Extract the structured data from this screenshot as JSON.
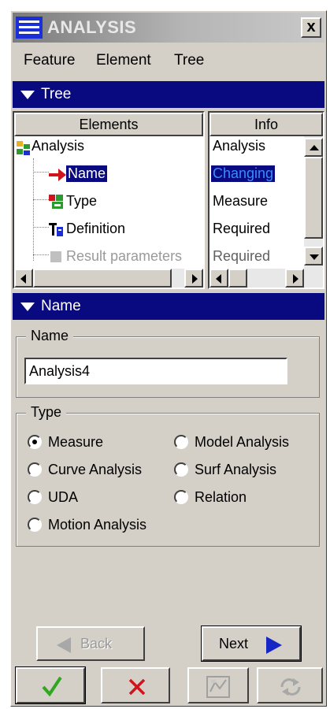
{
  "window": {
    "title": "ANALYSIS",
    "close_glyph": "x"
  },
  "menu": {
    "items": [
      "Feature",
      "Element",
      "Tree"
    ]
  },
  "tree_section": {
    "label": "Tree"
  },
  "tree": {
    "col_elements": "Elements",
    "col_info": "Info",
    "rows": [
      {
        "element": "Analysis",
        "info": "Analysis",
        "icon": "analysis-feature-icon"
      },
      {
        "element": "Name",
        "info": "Changing",
        "icon": "current-arrow-icon",
        "selected": true
      },
      {
        "element": "Type",
        "info": "Measure",
        "icon": "type-icon"
      },
      {
        "element": "Definition",
        "info": "Required",
        "icon": "definition-icon"
      },
      {
        "element": "Result parameters",
        "info": "Required",
        "icon": "result-parameters-icon"
      }
    ]
  },
  "name_section": {
    "label": "Name"
  },
  "name_group": {
    "label": "Name",
    "value": "Analysis4"
  },
  "type_group": {
    "label": "Type",
    "options": [
      {
        "label": "Measure",
        "checked": true
      },
      {
        "label": "Model Analysis",
        "checked": false
      },
      {
        "label": "Curve Analysis",
        "checked": false
      },
      {
        "label": "Surf Analysis",
        "checked": false
      },
      {
        "label": "UDA",
        "checked": false
      },
      {
        "label": "Relation",
        "checked": false
      },
      {
        "label": "Motion Analysis",
        "checked": false
      }
    ]
  },
  "nav": {
    "back_label": "Back",
    "next_label": "Next"
  },
  "colors": {
    "header_blue": "#0a0a80",
    "ok_green": "#2ea81e",
    "cancel_red": "#d0141c",
    "next_arrow": "#1626c4"
  }
}
